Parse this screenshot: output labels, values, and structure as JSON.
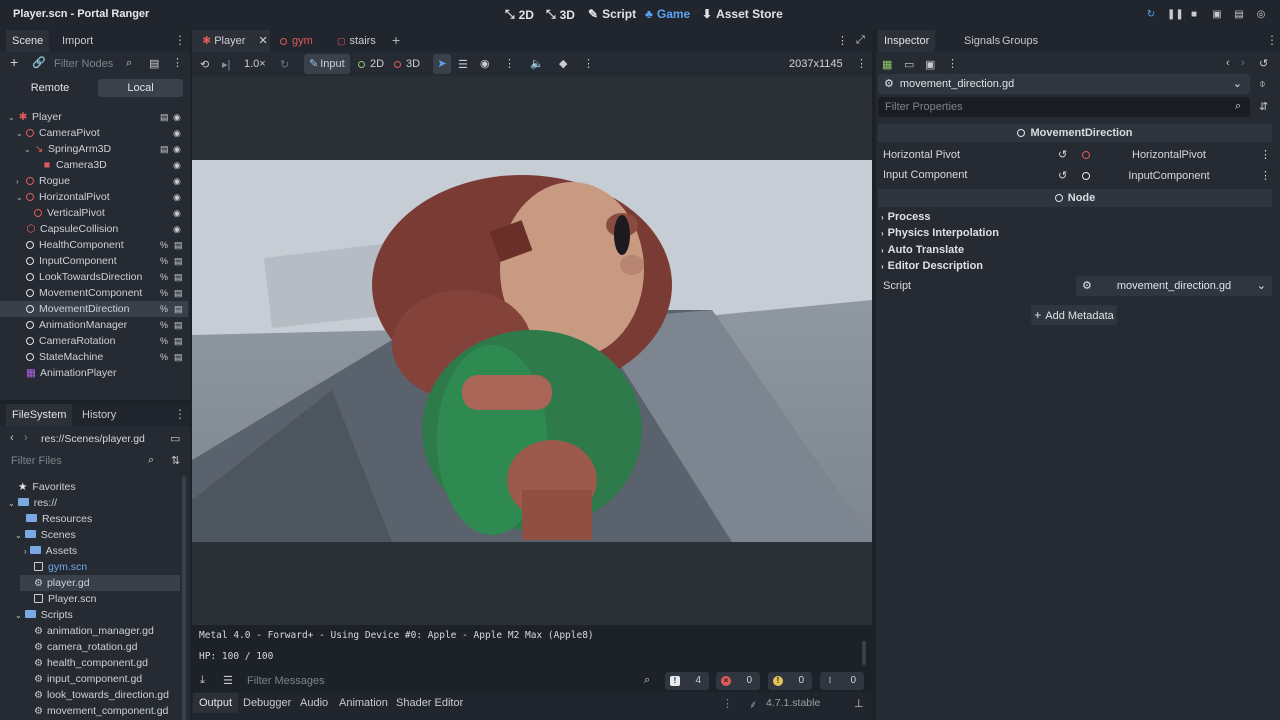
{
  "title": "Player.scn - Portal Ranger",
  "workspaces": [
    {
      "label": "2D",
      "icon": "2d-icon"
    },
    {
      "label": "3D",
      "icon": "3d-icon"
    },
    {
      "label": "Script",
      "icon": "script-icon"
    },
    {
      "label": "Game",
      "icon": "game-icon"
    },
    {
      "label": "Asset Store",
      "icon": "asset-store-icon"
    }
  ],
  "scene_dock": {
    "tabs": [
      "Scene",
      "Import"
    ],
    "filter_placeholder": "Filter Nodes",
    "remote_label": "Remote",
    "local_label": "Local",
    "nodes": [
      {
        "name": "Player",
        "depth": 0
      },
      {
        "name": "CameraPivot",
        "depth": 1
      },
      {
        "name": "SpringArm3D",
        "depth": 2
      },
      {
        "name": "Camera3D",
        "depth": 3
      },
      {
        "name": "Rogue",
        "depth": 1
      },
      {
        "name": "HorizontalPivot",
        "depth": 1
      },
      {
        "name": "VerticalPivot",
        "depth": 2
      },
      {
        "name": "CapsuleCollision",
        "depth": 1
      },
      {
        "name": "HealthComponent",
        "depth": 1
      },
      {
        "name": "InputComponent",
        "depth": 1
      },
      {
        "name": "LookTowardsDirection",
        "depth": 1
      },
      {
        "name": "MovementComponent",
        "depth": 1
      },
      {
        "name": "MovementDirection",
        "depth": 1
      },
      {
        "name": "AnimationManager",
        "depth": 1
      },
      {
        "name": "CameraRotation",
        "depth": 1
      },
      {
        "name": "StateMachine",
        "depth": 1
      },
      {
        "name": "AnimationPlayer",
        "depth": 1
      }
    ]
  },
  "filesystem": {
    "tabs": [
      "FileSystem",
      "History"
    ],
    "path": "res://Scenes/player.gd",
    "filter_placeholder": "Filter Files",
    "items": {
      "favorites": "Favorites",
      "res": "res://",
      "resources": "Resources",
      "scenes": "Scenes",
      "assets": "Assets",
      "gym": "gym.scn",
      "player_gd": "player.gd",
      "player_scn": "Player.scn",
      "scripts": "Scripts",
      "s1": "animation_manager.gd",
      "s2": "camera_rotation.gd",
      "s3": "health_component.gd",
      "s4": "input_component.gd",
      "s5": "look_towards_direction.gd",
      "s6": "movement_component.gd"
    }
  },
  "editor_tabs": [
    "Player",
    "gym",
    "stairs"
  ],
  "viewport_toolbar": {
    "speed": "1.0×",
    "input": "Input",
    "twod": "2D",
    "threed": "3D",
    "resolution": "2037x1145"
  },
  "output": {
    "line1": "Metal 4.0 - Forward+ - Using Device #0: Apple - Apple M2 Max (Apple8)",
    "line2": "HP: 100 / 100",
    "filter_placeholder": "Filter Messages",
    "counts": {
      "messages": "4",
      "errors": "0",
      "warnings": "0",
      "debug": "0"
    }
  },
  "bottom_tabs": [
    "Output",
    "Debugger",
    "Audio",
    "Animation",
    "Shader Editor"
  ],
  "version": "4.7.1.stable",
  "inspector": {
    "tabs": [
      "Inspector",
      "Signals",
      "Groups"
    ],
    "resource": "movement_direction.gd",
    "filter_placeholder": "Filter Properties",
    "class_name": "MovementDirection",
    "props": [
      {
        "label": "Horizontal Pivot",
        "value": "HorizontalPivot"
      },
      {
        "label": "Input Component",
        "value": "InputComponent"
      }
    ],
    "node_section": "Node",
    "categories": [
      "Process",
      "Physics Interpolation",
      "Auto Translate",
      "Editor Description"
    ],
    "script_label": "Script",
    "script_value": "movement_direction.gd",
    "add_metadata": "Add Metadata"
  },
  "colors": {
    "accent": "#5aa3f0",
    "node_red": "#e05a5a",
    "bg": "#1d2229"
  }
}
